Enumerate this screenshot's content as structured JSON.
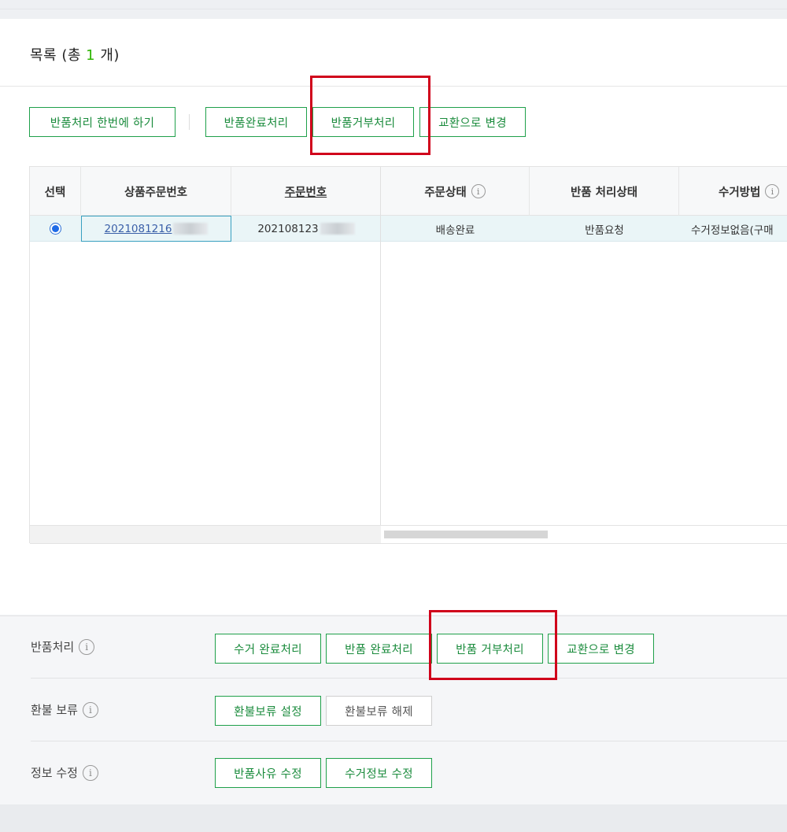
{
  "list": {
    "title_prefix": "목록 (총 ",
    "count": "1",
    "title_suffix": " 개)"
  },
  "toolbar": {
    "batch_return": "반품처리 한번에 하기",
    "return_complete": "반품완료처리",
    "return_reject": "반품거부처리",
    "change_exchange": "교환으로 변경"
  },
  "grid": {
    "headers": {
      "select": "선택",
      "product_order_no": "상품주문번호",
      "order_no": "주문번호",
      "order_status": "주문상태",
      "return_status": "반품 처리상태",
      "pickup_method": "수거방법"
    },
    "row": {
      "product_order_no": "2021081216",
      "order_no": "202108123",
      "order_status": "배송완료",
      "return_status": "반품요청",
      "pickup_method": "수거정보없음(구매"
    }
  },
  "actions": {
    "return_processing": {
      "label": "반품처리",
      "buttons": [
        "수거 완료처리",
        "반품 완료처리",
        "반품 거부처리",
        "교환으로 변경"
      ]
    },
    "refund_hold": {
      "label": "환불 보류",
      "buttons": [
        "환불보류 설정",
        "환불보류 해제"
      ]
    },
    "info_edit": {
      "label": "정보 수정",
      "buttons": [
        "반품사유 수정",
        "수거정보 수정"
      ]
    }
  },
  "icons": {
    "info": "info-circle-icon",
    "radio": "radio-selected-icon"
  },
  "colors": {
    "accent_green": "#1fa04a",
    "highlight_red": "#d0021b",
    "link_blue": "#3a5fa8",
    "selected_row": "#eaf5f7"
  }
}
